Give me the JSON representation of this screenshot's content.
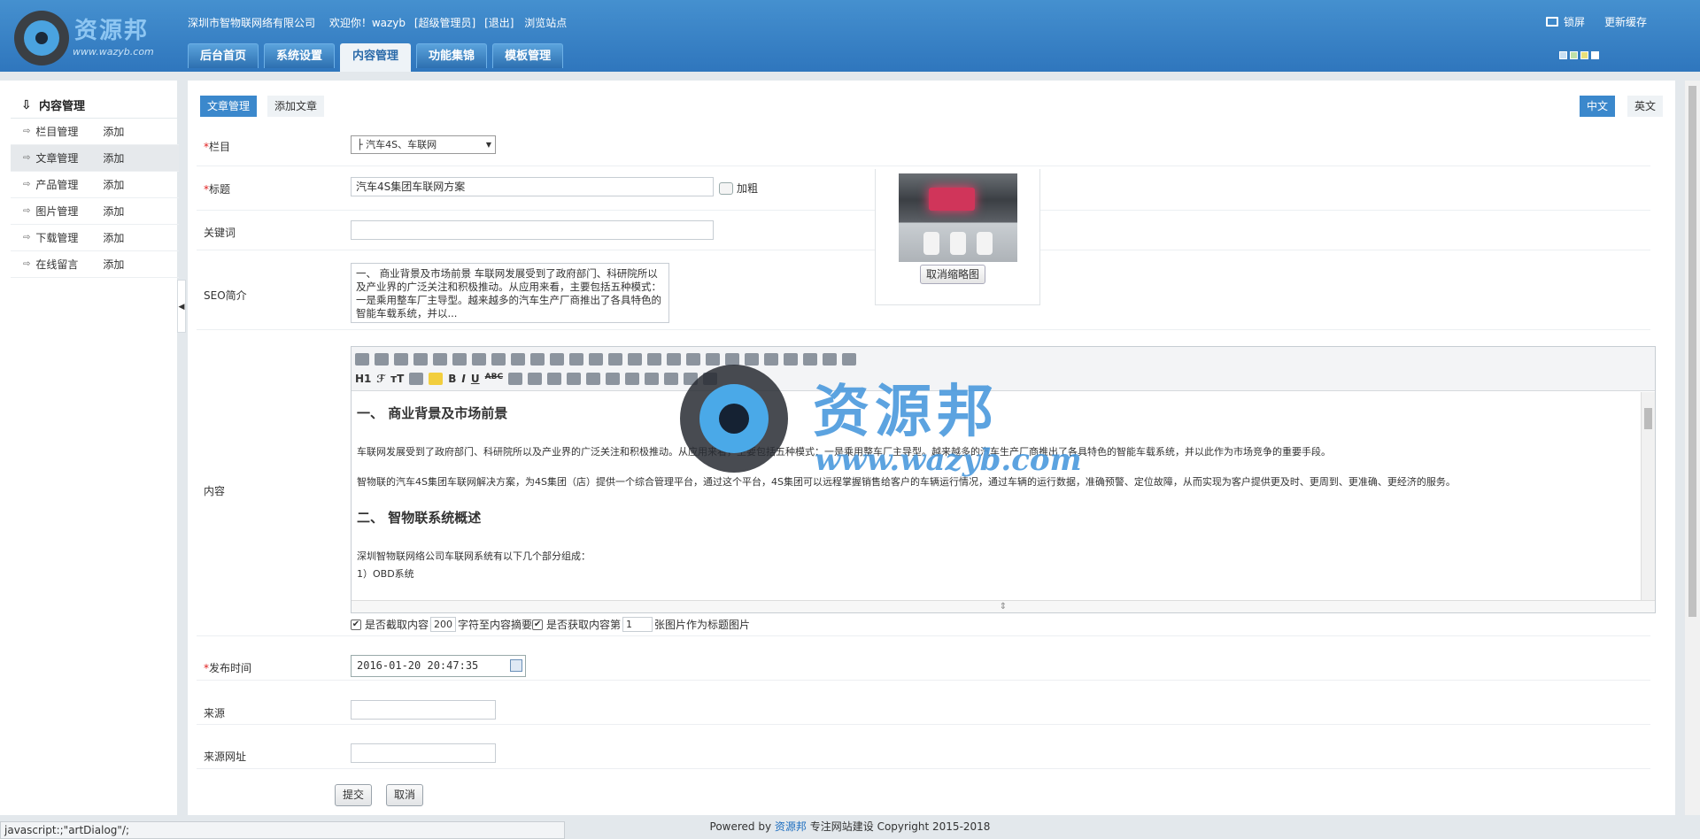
{
  "header": {
    "logo_cn": "资源邦",
    "logo_en": "www.wazyb.com",
    "company": "深圳市智物联网络有限公司",
    "welcome": "欢迎你！wazyb",
    "role": "[超级管理员]",
    "logout": "[退出]",
    "browse": "浏览站点",
    "lock": "锁屏",
    "refresh_cache": "更新缓存",
    "nav": [
      "后台首页",
      "系统设置",
      "内容管理",
      "功能集锦",
      "模板管理"
    ],
    "active_nav": "内容管理",
    "skin_colors": [
      "#c9dff2",
      "#bfe0a8",
      "#e8e07a",
      "#ffffff"
    ]
  },
  "sidebar": {
    "title": "内容管理",
    "items": [
      {
        "label": "栏目管理",
        "add": "添加"
      },
      {
        "label": "文章管理",
        "add": "添加"
      },
      {
        "label": "产品管理",
        "add": "添加"
      },
      {
        "label": "图片管理",
        "add": "添加"
      },
      {
        "label": "下载管理",
        "add": "添加"
      },
      {
        "label": "在线留言",
        "add": "添加"
      }
    ]
  },
  "tabs": {
    "manage": "文章管理",
    "add": "添加文章"
  },
  "lang": {
    "cn": "中文",
    "en": "英文"
  },
  "form": {
    "category_label": "栏目",
    "category_value": "├ 汽车4S、车联网",
    "title_label": "标题",
    "title_value": "汽车4S集团车联网方案",
    "bold_label": "加粗",
    "keywords_label": "关键词",
    "keywords_value": "",
    "seo_label": "SEO简介",
    "seo_value": "一、 商业背景及市场前景   车联网发展受到了政府部门、科研院所以及产业界的广泛关注和积极推动。从应用来看，主要包括五种模式：一是乘用整车厂主导型。越来越多的汽车生产厂商推出了各具特色的智能车载系统，并以...",
    "thumb_cancel": "取消缩略图",
    "content_label": "内容",
    "content_h1": "一、 商业背景及市场前景",
    "content_p1": "车联网发展受到了政府部门、科研院所以及产业界的广泛关注和积极推动。从应用来看，主要包括五种模式：一是乘用整车厂主导型。越来越多的汽车生产厂商推出了各具特色的智能车载系统，并以此作为市场竞争的重要手段。",
    "content_p2": "智物联的汽车4S集团车联网解决方案，为4S集团（店）提供一个综合管理平台，通过这个平台，4S集团可以远程掌握销售给客户的车辆运行情况，通过车辆的运行数据，准确预警、定位故障，从而实现为客户提供更及时、更周到、更准确、更经济的服务。",
    "content_h2": "二、 智物联系统概述",
    "content_p3": "深圳智物联网络公司车联网系统有以下几个部分组成：",
    "content_p4": "1）OBD系统",
    "opt1": "是否截取内容",
    "opt1_value": "200",
    "opt1_suffix": "字符至内容摘要",
    "opt2": "是否获取内容第",
    "opt2_value": "1",
    "opt2_suffix": "张图片作为标题图片",
    "date_label": "发布时间",
    "date_value": "2016-01-20 20:47:35",
    "source_label": "来源",
    "source_value": "",
    "source_url_label": "来源网址",
    "source_url_value": "",
    "submit": "提交",
    "cancel": "取消"
  },
  "editor_toolbar": {
    "heading": "H1",
    "font": "ℱ",
    "size": "тT",
    "bold": "B",
    "italic": "I",
    "underline": "U",
    "strike": "ABC"
  },
  "watermark": {
    "cn": "资源邦",
    "en": "www.wazyb.com"
  },
  "footer": {
    "powered": "Powered by",
    "brand": "资源邦",
    "tail": "专注网站建设  Copyright 2015-2018"
  },
  "status_text": "javascript:;\"artDialog\"/;"
}
